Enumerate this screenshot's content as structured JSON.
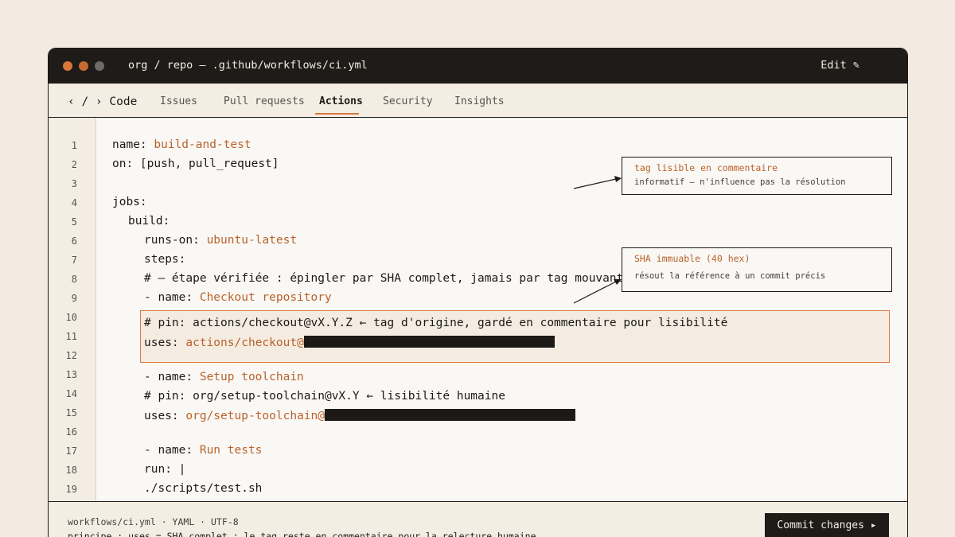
{
  "window": {
    "title": "org / repo — .github/workflows/ci.yml",
    "edit_label": "Edit ✎"
  },
  "tabs": {
    "code": "‹ / › Code",
    "issues": "Issues",
    "pulls": "Pull requests",
    "actions": "Actions",
    "security": "Security",
    "insights": "Insights",
    "active": "Actions"
  },
  "editor": {
    "line_numbers": [
      "1",
      "2",
      "3",
      "4",
      "5",
      "6",
      "7",
      "8",
      "9",
      "10",
      "11",
      "12",
      "13",
      "14",
      "15",
      "16",
      "17",
      "18",
      "19"
    ],
    "lines": {
      "l1_key": "name: ",
      "l1_val": "build-and-test",
      "l2": "on: [push, pull_request]",
      "l4": "jobs:",
      "l5": "build:",
      "l6_key": "runs-on: ",
      "l6_val": "ubuntu-latest",
      "l7": "steps:",
      "l8": "# — étape vérifiée : épingler par SHA complet, jamais par tag mouvant",
      "l9_key": "- name: ",
      "l9_val": "Checkout repository",
      "l10": "# pin: actions/checkout@vX.Y.Z ← tag d'origine, gardé en commentaire pour lisibilité",
      "l11_key": "uses: ",
      "l11_val": "actions/checkout@",
      "l13_key": "- name: ",
      "l13_val": "Setup toolchain",
      "l14": "# pin: org/setup-toolchain@vX.Y ← lisibilité humaine",
      "l15_key": "uses: ",
      "l15_val": "org/setup-toolchain@",
      "l17_key": "- name: ",
      "l17_val": "Run tests",
      "l18": "run: |",
      "l19": "./scripts/test.sh"
    }
  },
  "annotations": {
    "tag_title": "tag lisible en commentaire",
    "tag_text": "informatif — n'influence pas la résolution",
    "sha_title": "SHA immuable (40 hex)",
    "sha_text": "résout la référence à un commit précis"
  },
  "status": {
    "meta": "workflows/ci.yml · YAML · UTF-8",
    "principle": "principe : uses = SHA complet ; le tag reste en commentaire pour la relecture humaine",
    "commit_label": "Commit changes ▸"
  },
  "colors": {
    "accent": "#d9773a",
    "value": "#b9622a",
    "dark": "#1e1b18",
    "background": "#f3ebe1"
  }
}
